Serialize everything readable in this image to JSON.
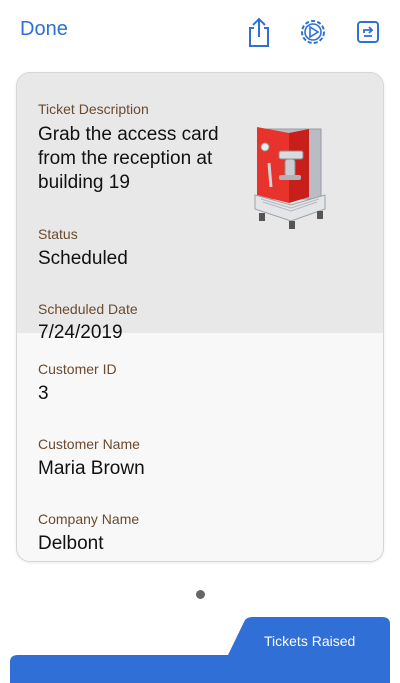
{
  "toolbar": {
    "done_label": "Done",
    "icons": [
      "share-icon",
      "settings-icon",
      "open-external-icon"
    ],
    "accent_color": "#2f6fd6"
  },
  "ticket": {
    "description_label": "Ticket Description",
    "description_lines": [
      "Grab the access card",
      "from the reception at",
      "building 19"
    ],
    "status_label": "Status",
    "status_value": "Scheduled",
    "scheduled_date_label": "Scheduled Date",
    "scheduled_date_value": "7/24/2019",
    "customer_id_label": "Customer ID",
    "customer_id_value": "3",
    "customer_name_label": "Customer Name",
    "customer_name_value": "Maria Brown",
    "company_name_label": "Company Name",
    "company_name_value": "Delbont",
    "image_icon": "espresso-machine-image",
    "label_color": "#6b4a2e"
  },
  "pager": {
    "total_pages": 1,
    "current_page": 1
  },
  "bottom_tab": {
    "label": "Tickets Raised",
    "color": "#2f6fd6"
  }
}
